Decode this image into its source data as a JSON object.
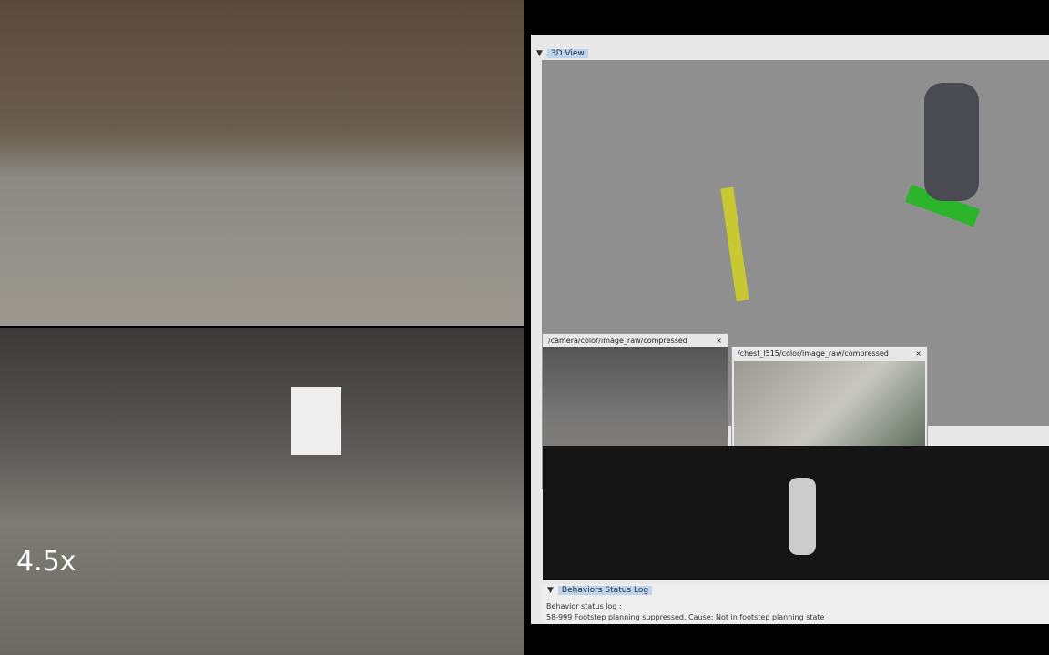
{
  "video": {
    "speed_label": "4.5x"
  },
  "rviz": {
    "view3d_title": "3D View",
    "camera_panel": {
      "title": "/camera/color/image_raw/compressed",
      "close": "×"
    },
    "chest_panel": {
      "title": "/chest_l515/color/image_raw/compressed",
      "close": "×"
    },
    "log_panel": {
      "title": "Behaviors Status Log",
      "line1": "Behavior status log :",
      "line2": "58-999 Footstep planning suppressed. Cause:  Not in footstep planning state"
    }
  }
}
